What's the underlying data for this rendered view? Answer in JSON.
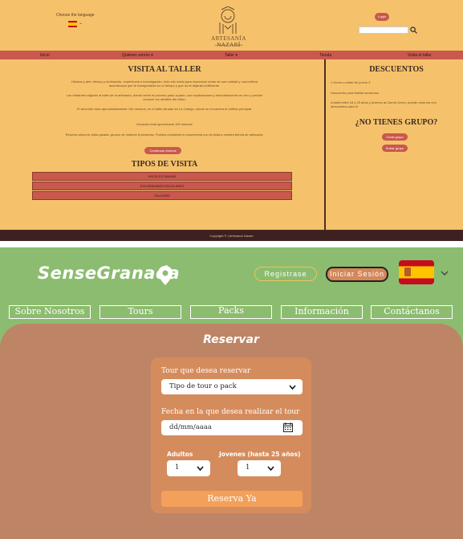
{
  "top": {
    "language_label": "Choose the language",
    "logo_title": "ARTESANÍA NAZARÍ",
    "logo_subtitle": "La maestría en tus manos",
    "login_label": "Login",
    "nav": [
      "Inicio",
      "Quiénes somos ▾",
      "Taller ▾",
      "Tienda",
      "Visita el taller"
    ],
    "visita_title": "VISITA AL TALLER",
    "paragraphs": [
      "Historia y arte, tiempo y dedicación, experiencia e investigación; todo ello unido para reproducir obras de una calidad y una belleza asombrosas que te transportarán en el tiempo y que no te dejarán indiferente.",
      "Los visitantes viajarán al taller de la artesanía, donde verán el proceso paso a paso, con explicaciones y demostraciones en vivo y podrán conocer los detalles del oficio.",
      "El recorrido dura aproximadamente 100 minutos, en el taller situado en La Cartuja, donde se encuentra el edificio principal.",
      "Duración total aproximada 100 minutos",
      "Reserva ahora tu visita guiada, grupos de máximo 8 personas. Puedes completar tu experiencia con la visita a nuestra tienda de artesanía."
    ],
    "reserve_label": "Comenzar reserva",
    "tipos_title": "TIPOS DE VISITA",
    "accordion": [
      "VISITA ESTÁNDAR",
      "EXCURSIONES ESCOLARES",
      "TALLERES"
    ],
    "descuentos_title": "DESCUENTOS",
    "descuentos": [
      "1 Horno a mitad de precio 3",
      "Descuento para familia numerosa",
      "A tarifa entre 18 y 25 años y jóvenes al Carnet Joven, podrán reservar con descuentos para el"
    ],
    "grupo_title": "¿NO TIENES GRUPO?",
    "grupo_buttons": [
      "Crear grupo",
      "Entrar grupo"
    ],
    "footer": "Copyright © | Artesanía Nazarí"
  },
  "bottom": {
    "brand": "SenseGranada",
    "register_label": "Registrase",
    "login_label": "Iniciar Sesión",
    "tabs": [
      "Sobre Nosotros",
      "Tours",
      "Packs",
      "Información",
      "Contáctanos"
    ],
    "reservar_title": "Reservar",
    "tour_label": "Tour que desea reservar",
    "tour_value": "Tipo de tour o pack",
    "date_label": "Fecha en la que desea realizar el tour",
    "date_placeholder": "dd/mm/aaaa",
    "adults_label": "Adultos",
    "adults_value": "1",
    "youth_label": "Jovenes (hasta 25 años)",
    "youth_value": "1",
    "submit_label": "Reserva Ya"
  },
  "colors": {
    "top_bg": "#f5c26b",
    "top_accent": "#c9584d",
    "bottom_green": "#8cbc6f",
    "bottom_panel": "#bd8566",
    "bottom_card": "#d58c5d",
    "bottom_button": "#f2a05a"
  }
}
